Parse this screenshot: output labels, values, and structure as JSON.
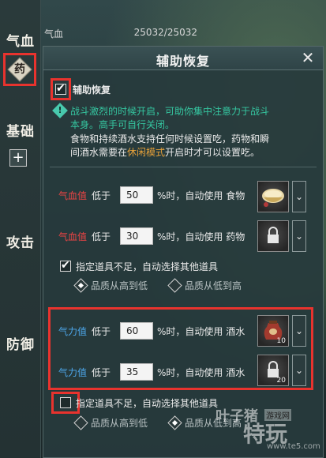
{
  "sidebar": {
    "categories": [
      "气血",
      "基础",
      "攻击",
      "防御"
    ],
    "yao_label": "药",
    "plus_label": "+"
  },
  "topbar": {
    "label": "气血",
    "value": "25032/25032"
  },
  "dialog": {
    "title": "辅助恢复",
    "close_label": "✕",
    "toggle_label": "辅助恢复",
    "info_line1": "战斗激烈的时候开启，可助你集中注意力于战斗",
    "info_line2": "本身。高手可自行关闭。",
    "desc_line1": "食物和持续酒水支持任何时候设置吃，药物和瞬",
    "desc_line2_pre": "间酒水需要在",
    "desc_line2_mode": "休闲模式",
    "desc_line2_post": "开启时才可以设置吃。",
    "hp_rules": [
      {
        "stat": "气血值",
        "lt": "低于",
        "value": "50",
        "suffix": "%时，自动使用 食物",
        "icon": "food-bowl-icon"
      },
      {
        "stat": "气血值",
        "lt": "低于",
        "value": "30",
        "suffix": "%时，自动使用 药物",
        "icon": "locked-slot-icon"
      }
    ],
    "hp_fallback": {
      "checked": true,
      "label": "指定道具不足，自动选择其他道具",
      "options": [
        "品质从高到低",
        "品质从低到高"
      ],
      "selected": 0
    },
    "stamina_rules": [
      {
        "stat": "气力值",
        "lt": "低于",
        "value": "60",
        "suffix": "%时，自动使用 酒水",
        "icon": "wine-jar-icon",
        "qty": "10"
      },
      {
        "stat": "气力值",
        "lt": "低于",
        "value": "35",
        "suffix": "%时，自动使用 酒水",
        "icon": "locked-slot-icon",
        "qty": "20"
      }
    ],
    "stamina_fallback": {
      "checked": false,
      "label": "指定道具不足，自动选择其他道具",
      "options": [
        "品质从高到低",
        "品质从低到高"
      ],
      "selected": 1
    },
    "dropdown_glyph": "⌄",
    "lock_glyph": "🔒"
  },
  "watermark": {
    "brand": "叶子猪",
    "sub": "游戏网",
    "big": "特玩",
    "url": "www.te5.com"
  },
  "colors": {
    "accent_red": "#e8332e",
    "teal": "#35c7a1",
    "hp_red": "#ee4444",
    "stamina_blue": "#4da8ec",
    "mode_orange": "#e8a23a"
  }
}
